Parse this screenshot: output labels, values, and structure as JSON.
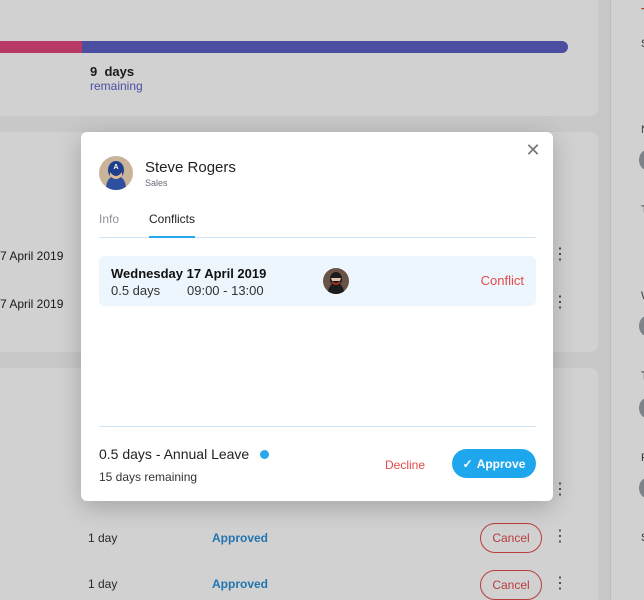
{
  "summary": {
    "days_value": "9",
    "days_unit": "days",
    "remaining_label": "remaining",
    "used_fraction": 0.145
  },
  "background_rows": [
    {
      "date": "7 April 2019"
    },
    {
      "date": "7 April 2019"
    }
  ],
  "request_rows": [
    {
      "days": "1 day",
      "status": "Approved",
      "cancel_label": "Cancel"
    },
    {
      "days": "1 day",
      "status": "Approved",
      "cancel_label": "Cancel"
    }
  ],
  "right_panel": {
    "letters": [
      "T",
      "S",
      "N",
      "T",
      "W",
      "T",
      "F",
      "S"
    ]
  },
  "modal": {
    "user": {
      "name": "Steve Rogers",
      "department": "Sales"
    },
    "tabs": [
      {
        "label": "Info",
        "active": false
      },
      {
        "label": "Conflicts",
        "active": true
      }
    ],
    "conflict": {
      "date": "Wednesday 17 April 2019",
      "days": "0.5 days",
      "time": "09:00 - 13:00",
      "status": "Conflict"
    },
    "leave": {
      "summary": "0.5 days - Annual Leave",
      "remaining": "15 days remaining"
    },
    "actions": {
      "decline_label": "Decline",
      "approve_label": "Approve"
    }
  },
  "colors": {
    "accent": "#1fa7ee",
    "danger": "#e24b4b",
    "progress_used": "#e0467c",
    "progress_total": "#5c60c4"
  }
}
